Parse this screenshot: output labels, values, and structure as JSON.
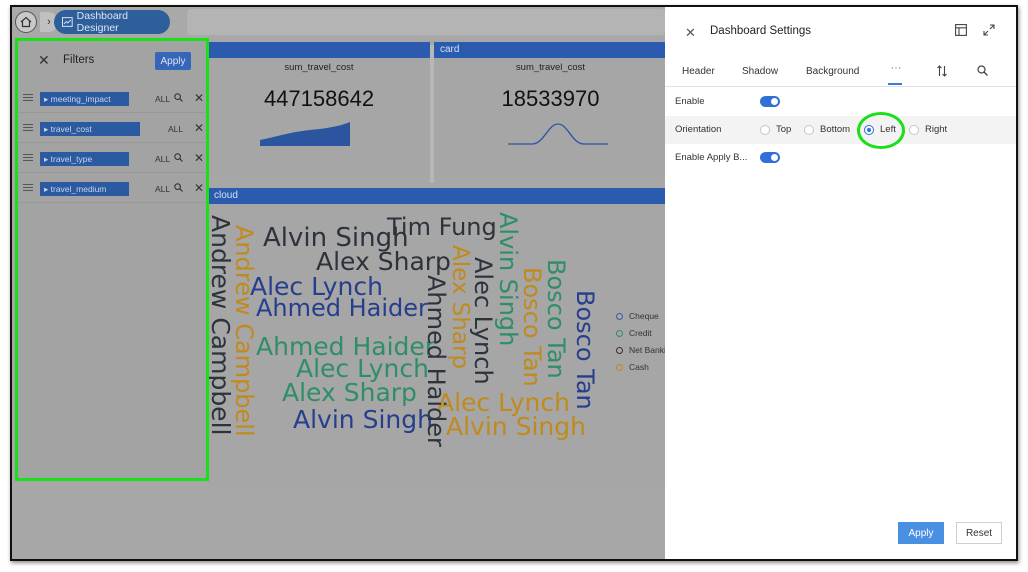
{
  "nav": {
    "breadcrumb_label": "Dashboard Designer"
  },
  "cards": [
    {
      "header": "",
      "title": "sum_travel_cost",
      "value": "447158642"
    },
    {
      "header": "card",
      "title": "sum_travel_cost",
      "value": "18533970"
    }
  ],
  "wordcloud": {
    "header": "cloud",
    "words": [
      {
        "text": "Alvin Singh",
        "color": "dark"
      },
      {
        "text": "Tim Fung",
        "color": "dark"
      },
      {
        "text": "Alex Sharp",
        "color": "dark"
      },
      {
        "text": "Alec Lynch",
        "color": "blue"
      },
      {
        "text": "Ahmed Haider",
        "color": "blue"
      },
      {
        "text": "Ahmed Haider",
        "color": "green"
      },
      {
        "text": "Alec Lynch",
        "color": "green"
      },
      {
        "text": "Alex Sharp",
        "color": "green"
      },
      {
        "text": "Alvin Singh",
        "color": "blue"
      },
      {
        "text": "Alec Lynch",
        "color": "orange"
      },
      {
        "text": "Alvin Singh",
        "color": "orange"
      },
      {
        "text": "Andrew Campbell",
        "color": "dark"
      },
      {
        "text": "Andrew Campbell",
        "color": "orange"
      },
      {
        "text": "Alex Sharp",
        "color": "orange"
      },
      {
        "text": "Ahmed Haider",
        "color": "dark"
      },
      {
        "text": "Alec Lynch",
        "color": "dark"
      },
      {
        "text": "Alvin Singh",
        "color": "green"
      },
      {
        "text": "Bosco Tan",
        "color": "orange"
      },
      {
        "text": "Bosco Tan",
        "color": "green"
      },
      {
        "text": "Bosco Tan",
        "color": "blue"
      }
    ],
    "legend": [
      {
        "label": "Cheque",
        "color": "#3a5ba8"
      },
      {
        "label": "Credit",
        "color": "#2e8e68"
      },
      {
        "label": "Net Banki",
        "color": "#333333"
      },
      {
        "label": "Cash",
        "color": "#c18a1d"
      }
    ]
  },
  "filters": {
    "title": "Filters",
    "apply_label": "Apply",
    "items": [
      {
        "name": "meeting_impact",
        "all": "ALL",
        "search": true
      },
      {
        "name": "travel_cost",
        "all": "ALL",
        "search": false
      },
      {
        "name": "travel_type",
        "all": "ALL",
        "search": true
      },
      {
        "name": "travel_medium",
        "all": "ALL",
        "search": true
      }
    ]
  },
  "settings": {
    "title": "Dashboard Settings",
    "tabs": [
      "Header",
      "Shadow",
      "Background",
      "···"
    ],
    "enable_label": "Enable",
    "orientation_label": "Orientation",
    "orientation_options": [
      "Top",
      "Bottom",
      "Left",
      "Right"
    ],
    "orientation_selected": "Left",
    "enable_apply_label": "Enable Apply B...",
    "apply_label": "Apply",
    "reset_label": "Reset",
    "accent_color": "#2f6fd6"
  }
}
